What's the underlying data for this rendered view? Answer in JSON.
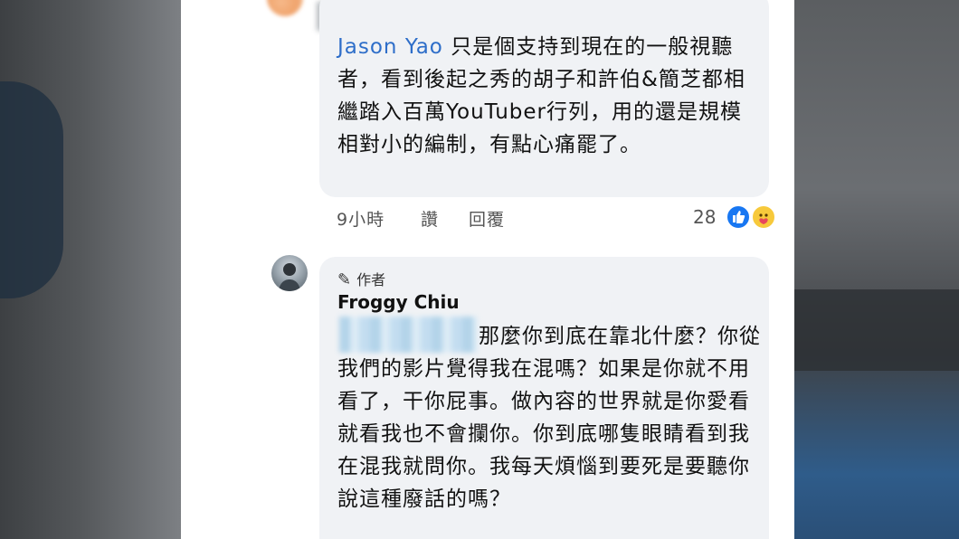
{
  "comment1": {
    "author": "Jason Yao",
    "text": "只是個支持到現在的一般視聽者，看到後起之秀的胡子和許伯&簡芝都相繼踏入百萬YouTuber行列，用的還是規模相對小的編制，有點心痛罷了。",
    "time": "9小時",
    "read_label": "讚",
    "reply_label": "回覆",
    "reaction_count": "28",
    "reactions": [
      "like-icon",
      "care-icon"
    ]
  },
  "comment2": {
    "badge_label": "作者",
    "badge_icon": "pencil-icon",
    "author": "Froggy Chiu",
    "text": "那麼你到底在靠北什麼？你從我們的影片覺得我在混嗎？如果是你就不用看了，干你屁事。做內容的世界就是你愛看就看我也不會攔你。你到底哪隻眼睛看到我在混我就問你。我每天煩惱到要死是要聽你說這種廢話的嗎？"
  },
  "colors": {
    "author_link": "#2e6ec9",
    "bubble": "#f0f2f5",
    "like": "#1877f2",
    "care": "#f7c93b"
  }
}
